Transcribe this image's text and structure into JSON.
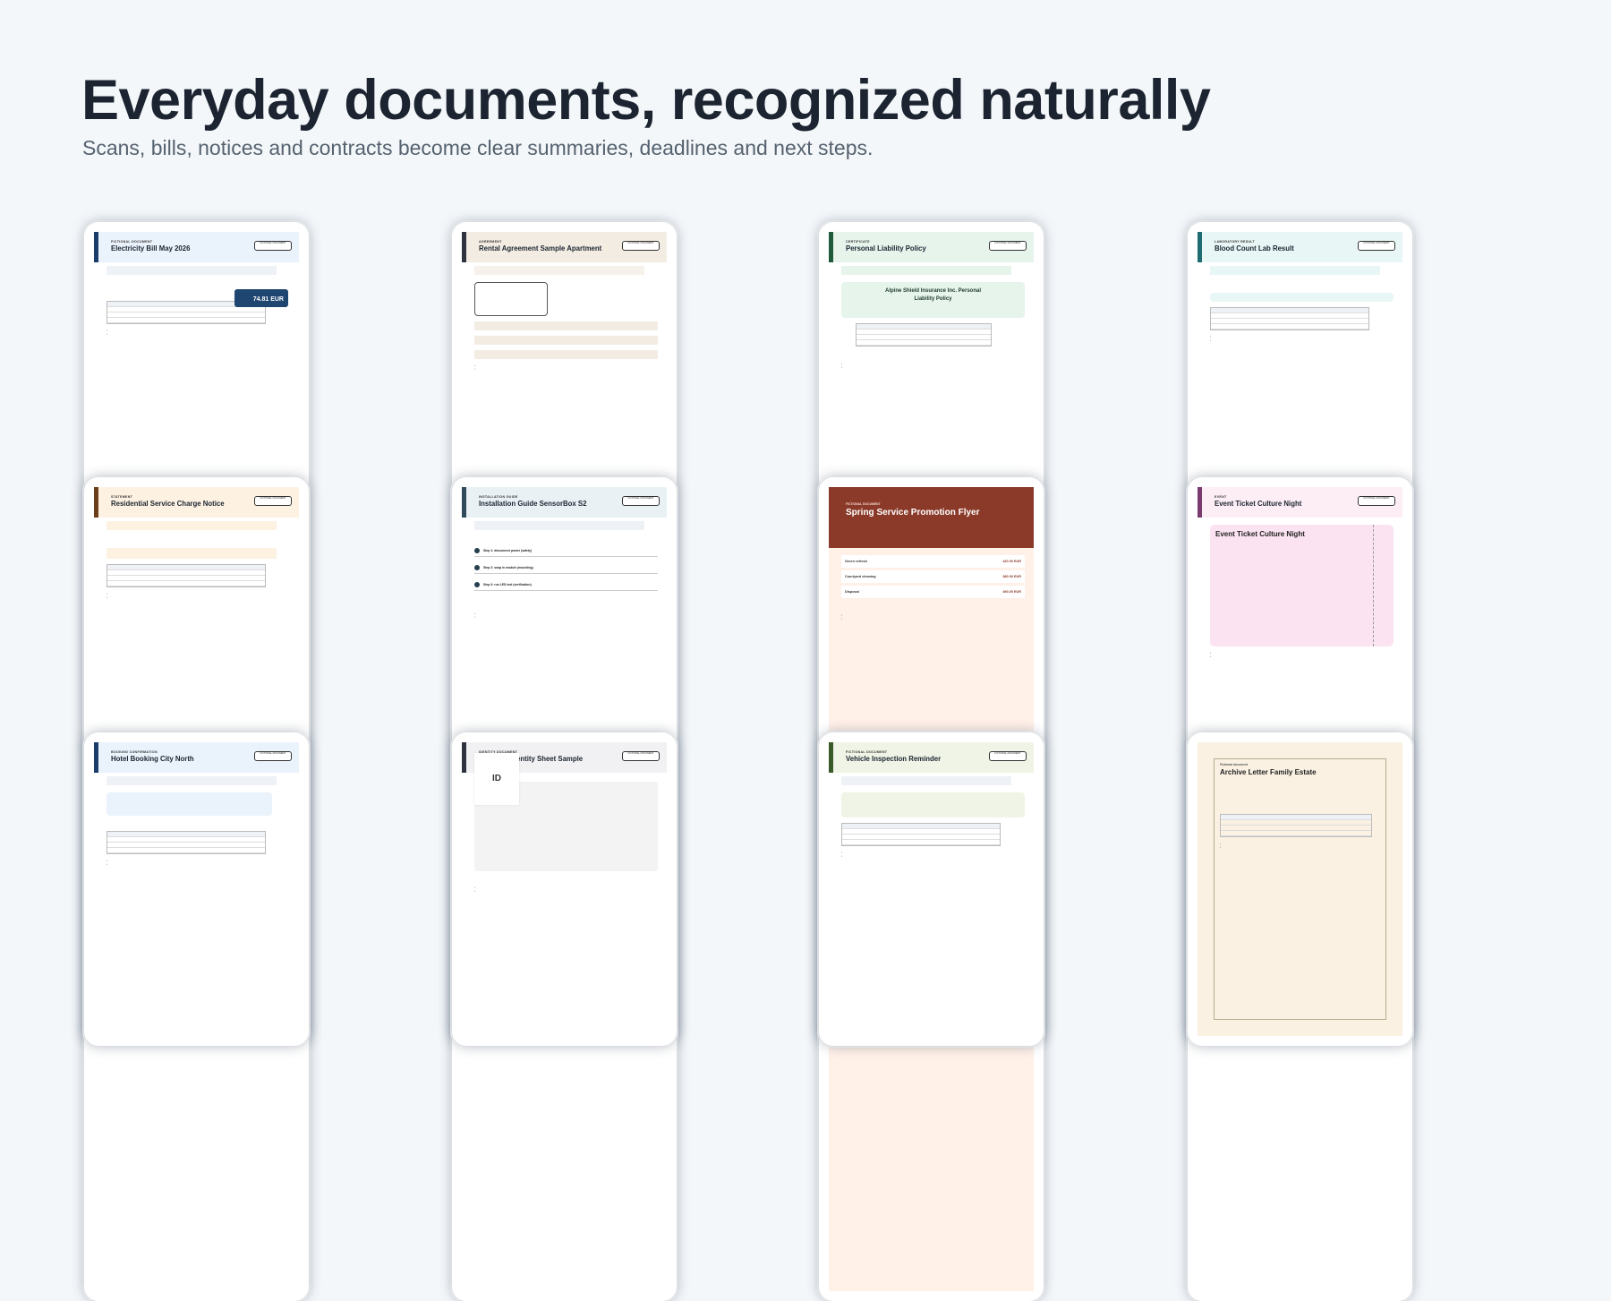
{
  "hero": {
    "title": "Everyday documents, recognized naturally",
    "subtitle": "Scans, bills, notices and contracts become clear summaries, deadlines and next steps."
  },
  "documents": [
    {
      "kind": "Fictional document",
      "title": "Electricity Bill May 2026",
      "badge": "FICTIONAL DOCUMENT",
      "total": "74.81 EUR",
      "accent": "#1a3d6b",
      "tint": "#eaf2fb"
    },
    {
      "kind": "Agreement",
      "title": "Rental Agreement Sample Apartment",
      "badge": "FICTIONAL DOCUMENT",
      "accent": "#2f3340",
      "tint": "#f3ece3"
    },
    {
      "kind": "Certificate",
      "title": "Personal Liability Policy",
      "badge": "FICTIONAL DOCUMENT",
      "card_title": "Alpine Shield Insurance Inc. Personal Liability Policy",
      "accent": "#1f5a3a",
      "tint": "#e6f4ec"
    },
    {
      "kind": "Laboratory result",
      "title": "Blood Count Lab Result",
      "badge": "FICTIONAL DOCUMENT",
      "accent": "#1f6c72",
      "tint": "#e8f6f5"
    },
    {
      "kind": "Statement",
      "title": "Residential Service Charge Notice",
      "badge": "FICTIONAL DOCUMENT",
      "accent": "#6a3f1a",
      "tint": "#fdf1e2"
    },
    {
      "kind": "Installation guide",
      "title": "Installation Guide SensorBox S2",
      "badge": "FICTIONAL DOCUMENT",
      "steps": [
        "Step 1: disconnect power (safety)",
        "Step 2: snap in module (mounting)",
        "Step 3: run LED test (verification)"
      ],
      "accent": "#2f4a5b",
      "tint": "#e9f1f5"
    },
    {
      "kind": "Fictional document",
      "title": "Spring Service Promotion Flyer",
      "items": [
        "Green refresh",
        "Courtyard cleaning",
        "Disposal"
      ],
      "prices": [
        "420.00 EUR",
        "380.00 EUR",
        "490.00 EUR"
      ],
      "accent": "#8b3a2a",
      "tint": "#fdebe3"
    },
    {
      "kind": "Event",
      "title": "Event Ticket Culture Night",
      "badge": "FICTIONAL DOCUMENT",
      "ticket_title": "Event Ticket Culture Night",
      "accent": "#7a3c6e",
      "tint": "#fbe3f1"
    },
    {
      "kind": "Booking confirmation",
      "title": "Hotel Booking City North",
      "badge": "FICTIONAL DOCUMENT",
      "accent": "#1a3d6b",
      "tint": "#eaf2fb"
    },
    {
      "kind": "Identity document",
      "title": "Personal Identity Sheet Sample",
      "badge": "FICTIONAL DOCUMENT",
      "photo_label": "ID",
      "accent": "#2f3340",
      "tint": "#f1f1f3"
    },
    {
      "kind": "Fictional document",
      "title": "Vehicle Inspection Reminder",
      "badge": "FICTIONAL DOCUMENT",
      "accent": "#3a5a2a",
      "tint": "#eff4e6"
    },
    {
      "kind": "Fictional document",
      "title": "Archive Letter Family Estate",
      "accent": "#a8956f",
      "tint": "#faf1e3"
    }
  ]
}
